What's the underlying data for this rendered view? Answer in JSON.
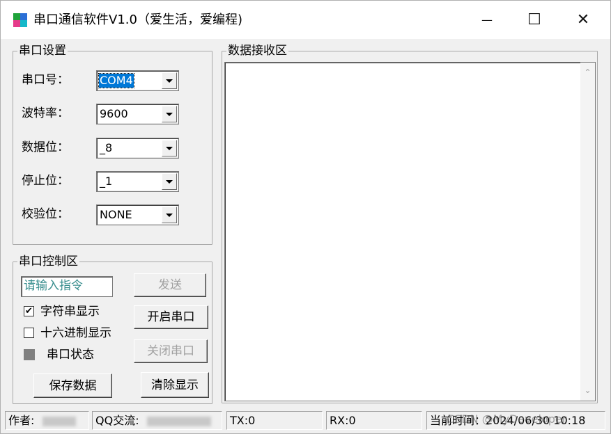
{
  "window": {
    "title": "串口通信软件V1.0（爱生活，爱编程)",
    "controls": {
      "minimize": "—",
      "maximize": "☐",
      "close": "✕"
    }
  },
  "serial_settings": {
    "legend": "串口设置",
    "fields": [
      {
        "label": "串口号：",
        "value": "COM4"
      },
      {
        "label": "波特率：",
        "value": "9600"
      },
      {
        "label": "数据位：",
        "value": "_8"
      },
      {
        "label": "停止位：",
        "value": "_1"
      },
      {
        "label": "校验位：",
        "value": "NONE"
      }
    ]
  },
  "serial_control": {
    "legend": "串口控制区",
    "command_placeholder": "请输入指令",
    "send_button": "发送",
    "open_button": "开启串口",
    "close_button": "关闭串口",
    "save_button": "保存数据",
    "clear_button": "清除显示",
    "show_string": {
      "label": "字符串显示",
      "checked": true
    },
    "show_hex": {
      "label": "十六进制显示",
      "checked": false
    },
    "status_label": "串口状态",
    "status_color": "#808080"
  },
  "receive_area": {
    "legend": "数据接收区",
    "content": ""
  },
  "statusbar": {
    "author_label": "作者:",
    "qq_label": "QQ交流:",
    "tx": "TX:0",
    "rx": "RX:0",
    "time": "当前时间：2024/06/30  10:18"
  },
  "watermark": "CSDN @MyDeveloper"
}
